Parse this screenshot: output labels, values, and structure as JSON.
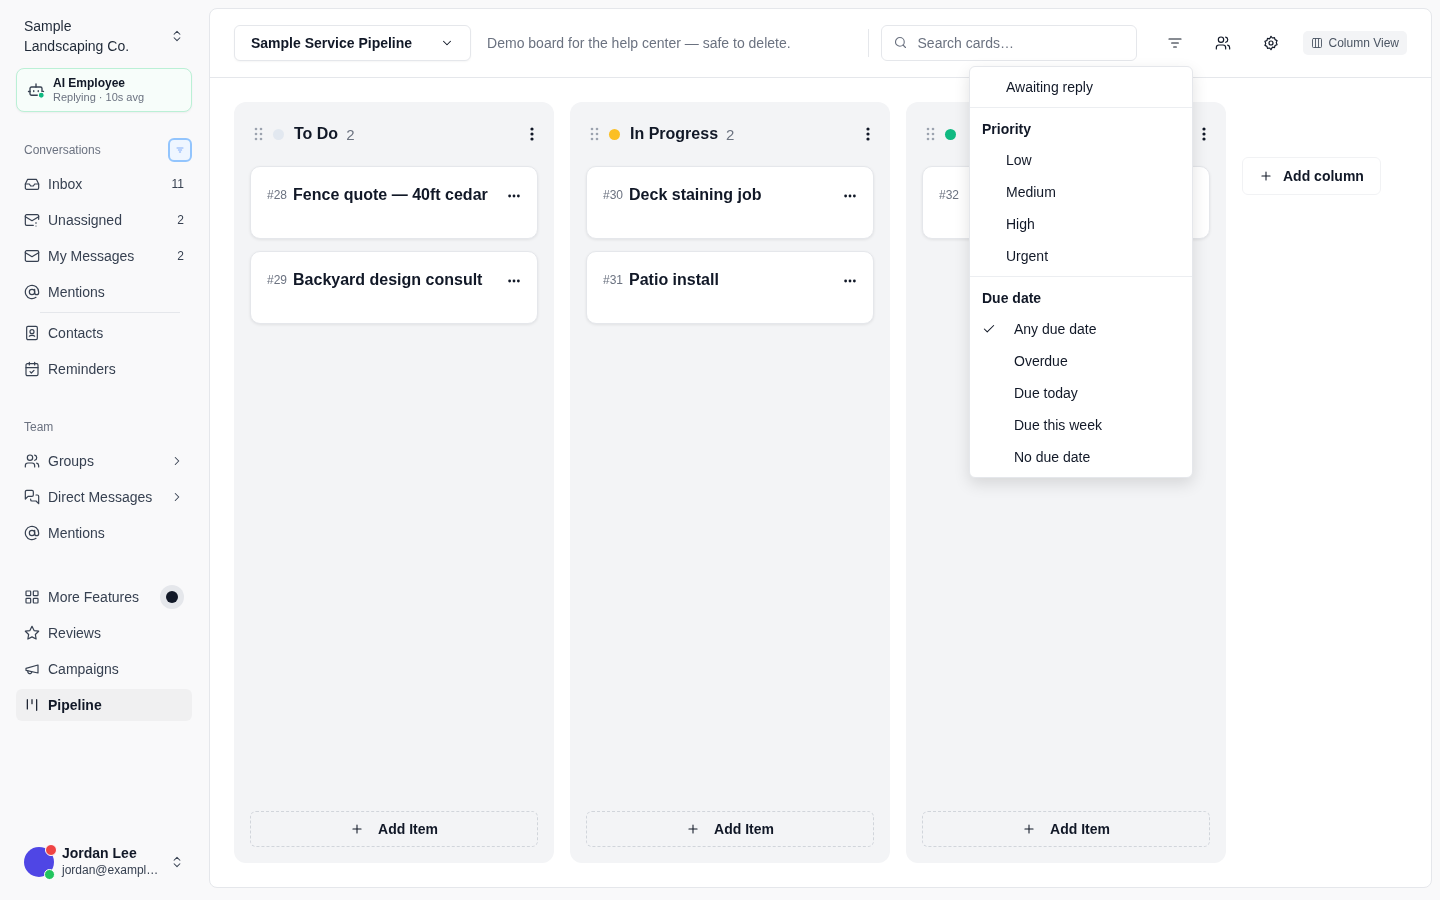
{
  "workspace": {
    "name": "Sample Landscaping Co."
  },
  "ai_status": {
    "title": "AI Employee",
    "subtitle": "Replying · 10s avg",
    "online": true
  },
  "sidebar": {
    "sections": [
      {
        "label": "Conversations",
        "groups": [
          [
            {
              "label": "Inbox",
              "count": "11",
              "kind": "link",
              "selected": false
            },
            {
              "label": "Unassigned",
              "count": "2",
              "kind": "link",
              "selected": false
            },
            {
              "label": "My Messages",
              "count": "2",
              "kind": "link",
              "selected": false
            },
            {
              "label": "Mentions",
              "kind": "link",
              "selected": false
            }
          ],
          [
            {
              "label": "Contacts",
              "kind": "link",
              "selected": false
            },
            {
              "label": "Reminders",
              "kind": "link",
              "selected": false
            }
          ]
        ]
      },
      {
        "label": "Team",
        "groups": [
          [
            {
              "label": "Groups",
              "kind": "expandable",
              "selected": false
            },
            {
              "label": "Direct Messages",
              "kind": "expandable",
              "selected": false
            },
            {
              "label": "Mentions",
              "kind": "link",
              "selected": false
            }
          ]
        ]
      },
      {
        "groups": [
          [
            {
              "label": "More Features",
              "kind": "dot",
              "selected": false
            },
            {
              "label": "Reviews",
              "kind": "link",
              "selected": false
            },
            {
              "label": "Campaigns",
              "kind": "link",
              "selected": false
            },
            {
              "label": "Pipeline",
              "kind": "link",
              "selected": true
            }
          ]
        ]
      }
    ]
  },
  "user": {
    "name": "Jordan Lee",
    "email": "jordan@exampl…",
    "online": true,
    "notification": true
  },
  "toolbar": {
    "pipeline": "Sample Service Pipeline",
    "description": "Demo board for the help center — safe to delete.",
    "search": {
      "placeholder": "Search cards…"
    },
    "view_button": "Column View"
  },
  "columns": [
    {
      "title": "To Do",
      "count": "2",
      "color": "#e2e8f0",
      "cards": [
        {
          "number": "#28",
          "title": "Fence quote — 40ft cedar"
        },
        {
          "number": "#29",
          "title": "Backyard design consult"
        }
      ],
      "add_label": "Add Item"
    },
    {
      "title": "In Progress",
      "count": "2",
      "color": "#fbbf24",
      "cards": [
        {
          "number": "#30",
          "title": "Deck staining job"
        },
        {
          "number": "#31",
          "title": "Patio install"
        }
      ],
      "add_label": "Add Item"
    },
    {
      "color": "#10b981",
      "cards": [
        {
          "number": "#32"
        }
      ],
      "add_label": "Add Item"
    }
  ],
  "add_column": "Add column",
  "filter_menu": {
    "groups": [
      {
        "kind": "plain",
        "options": [
          {
            "label": "Awaiting reply",
            "selected": false
          }
        ]
      },
      {
        "kind": "plain",
        "heading": "Priority",
        "options": [
          {
            "label": "Low",
            "selected": false
          },
          {
            "label": "Medium",
            "selected": false
          },
          {
            "label": "High",
            "selected": false
          },
          {
            "label": "Urgent",
            "selected": false
          }
        ]
      },
      {
        "kind": "radio",
        "heading": "Due date",
        "options": [
          {
            "label": "Any due date",
            "selected": true
          },
          {
            "label": "Overdue",
            "selected": false
          },
          {
            "label": "Due today",
            "selected": false
          },
          {
            "label": "Due this week",
            "selected": false
          },
          {
            "label": "No due date",
            "selected": false
          }
        ]
      }
    ]
  }
}
